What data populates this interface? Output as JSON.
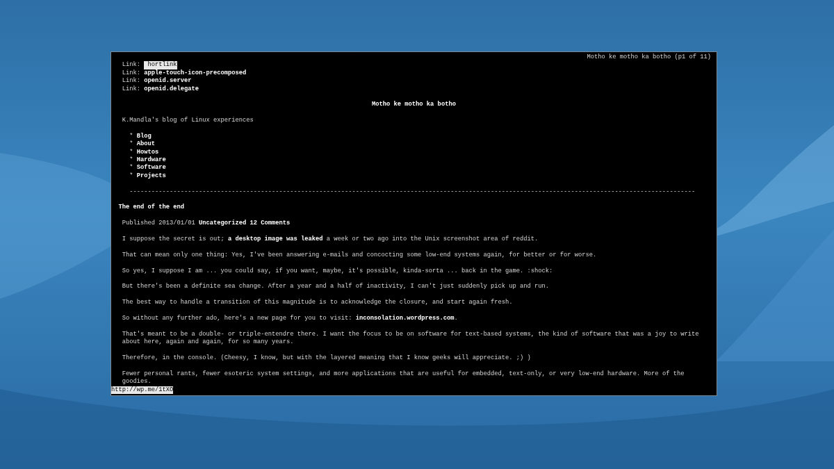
{
  "window": {
    "title": "Motho ke motho ka botho (p1 of 11)"
  },
  "links": [
    {
      "label": "Link:",
      "target": "hortlink",
      "selected": true
    },
    {
      "label": "Link:",
      "target": "apple-touch-icon-precomposed",
      "selected": false
    },
    {
      "label": "Link:",
      "target": "openid.server",
      "selected": false
    },
    {
      "label": "Link:",
      "target": "openid.delegate",
      "selected": false
    }
  ],
  "heading": "Motho ke motho ka botho",
  "tagline": "K.Mandla's blog of Linux experiences",
  "nav": [
    {
      "bullet": "*",
      "label": "Blog"
    },
    {
      "bullet": "*",
      "label": "About"
    },
    {
      "bullet": "*",
      "label": "Howtos"
    },
    {
      "bullet": "*",
      "label": "Hardware"
    },
    {
      "bullet": "*",
      "label": "Software"
    },
    {
      "bullet": "*",
      "label": "Projects"
    }
  ],
  "rule": "-----------------------------------------------------------------------------------------------------------------------------------------------------------",
  "post": {
    "title": "The end of the end",
    "meta": [
      {
        "kind": "text",
        "text": "Published 2013/01/01 "
      },
      {
        "kind": "link",
        "text": "Uncategorized"
      },
      {
        "kind": "link",
        "text": "12 Comments"
      }
    ],
    "paragraphs": [
      [
        {
          "kind": "text",
          "text": "I suppose the secret is out; "
        },
        {
          "kind": "link",
          "text": "a desktop image was leaked"
        },
        {
          "kind": "text",
          "text": " a week or two ago into the Unix screenshot area of reddit."
        }
      ],
      [
        {
          "kind": "text",
          "text": "That can mean only one thing: Yes, I've been answering e-mails and concocting some low-end systems again, for better or for worse."
        }
      ],
      [
        {
          "kind": "text",
          "text": "So yes, I suppose I am ... you could say, if you want, maybe, it's possible, kinda-sorta ... back in the game. :shock:"
        }
      ],
      [
        {
          "kind": "text",
          "text": "But there's been a definite sea change. After a year and a half of inactivity, I can't just suddenly pick up and run."
        }
      ],
      [
        {
          "kind": "text",
          "text": "The best way to handle a transition of this magnitude is to acknowledge the closure, and start again fresh."
        }
      ],
      [
        {
          "kind": "text",
          "text": "So without any further ado, here's a new page for you to visit: "
        },
        {
          "kind": "link",
          "text": "inconsolation.wordpress.com"
        },
        {
          "kind": "text",
          "text": "."
        }
      ],
      [
        {
          "kind": "text",
          "text": "That's meant to be a double- or triple-entendre there. I want the focus to be on software for text-based systems, the kind of software that was a joy to write about here, again and again, for so many years."
        }
      ],
      [
        {
          "kind": "text",
          "text": "Therefore, in the console. (Cheesy, I know, but with the layered meaning that I know geeks will appreciate. ;) )"
        }
      ],
      [
        {
          "kind": "text",
          "text": "Fewer personal rants, fewer esoteric system settings, and more applications that are useful for embedded, text-only, or very low-end hardware. More of the goodies."
        }
      ]
    ]
  },
  "status_bar": {
    "text": "http://wp.me/1tXO"
  }
}
